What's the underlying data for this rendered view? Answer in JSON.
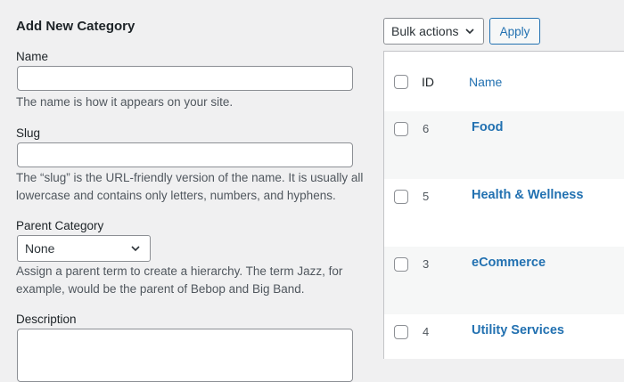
{
  "form": {
    "heading": "Add New Category",
    "name_label": "Name",
    "name_value": "",
    "name_help": "The name is how it appears on your site.",
    "slug_label": "Slug",
    "slug_value": "",
    "slug_help": "The “slug” is the URL-friendly version of the name. It is usually all lowercase and contains only letters, numbers, and hyphens.",
    "parent_label": "Parent Category",
    "parent_selected": "None",
    "parent_help": "Assign a parent term to create a hierarchy. The term Jazz, for example, would be the parent of Bebop and Big Band.",
    "description_label": "Description",
    "description_value": ""
  },
  "toolbar": {
    "bulk_actions_selected": "Bulk actions",
    "apply_label": "Apply"
  },
  "table": {
    "columns": {
      "id": "ID",
      "name": "Name"
    },
    "rows": [
      {
        "id": "6",
        "name": "Food"
      },
      {
        "id": "5",
        "name": "Health & Wellness"
      },
      {
        "id": "3",
        "name": "eCommerce"
      },
      {
        "id": "4",
        "name": "Utility Services"
      }
    ]
  },
  "colors": {
    "link": "#2271b1",
    "background": "#f0f0f1",
    "border": "#8c8f94"
  }
}
